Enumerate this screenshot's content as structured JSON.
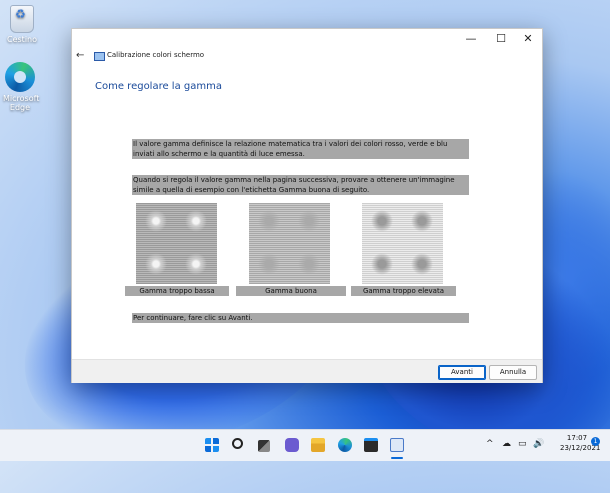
{
  "desktop": {
    "icons": [
      {
        "label": "Cestino",
        "icon": "recycle-bin-icon"
      },
      {
        "label": "Microsoft Edge",
        "icon": "edge-icon"
      }
    ]
  },
  "window": {
    "title": "Calibrazione colori schermo",
    "controls": {
      "minimize": "—",
      "maximize": "☐",
      "close": "✕"
    },
    "back": "←",
    "heading": "Come regolare la gamma",
    "paragraphs": [
      "Il valore gamma definisce la relazione matematica tra i valori dei colori rosso, verde e blu inviati allo schermo e la quantità di luce emessa.",
      "Quando si regola il valore gamma nella pagina successiva, provare a ottenere un'immagine simile a quella di esempio con l'etichetta Gamma buona di seguito.",
      "Per continuare, fare clic su Avanti."
    ],
    "samples": [
      {
        "caption": "Gamma troppo bassa"
      },
      {
        "caption": "Gamma buona"
      },
      {
        "caption": "Gamma troppo elevata"
      }
    ],
    "buttons": {
      "next": "Avanti",
      "cancel": "Annulla"
    }
  },
  "taskbar": {
    "icons": [
      "start-icon",
      "search-icon",
      "task-view-icon",
      "chat-icon",
      "file-explorer-icon",
      "edge-icon",
      "store-icon",
      "display-calibration-icon"
    ],
    "tray": {
      "chevron": "^",
      "network": "☁",
      "speaker": "▭",
      "volume": "🔊"
    },
    "time": "17:07",
    "date": "23/12/2021",
    "notifications": "1"
  }
}
